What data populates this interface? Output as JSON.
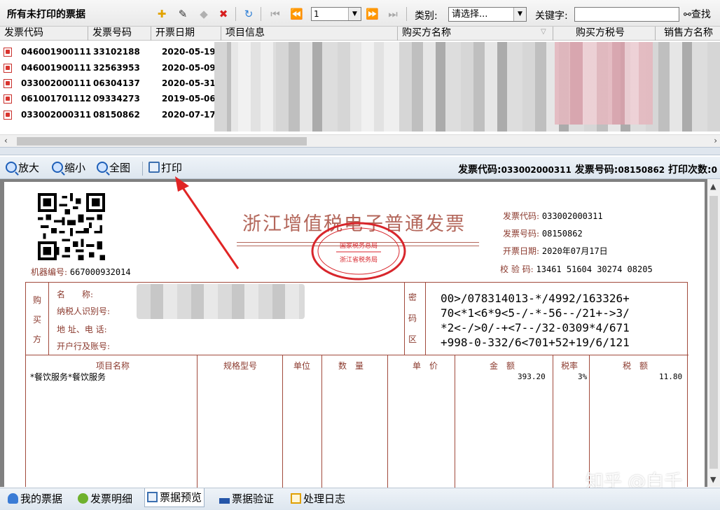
{
  "toolbar": {
    "title": "所有未打印的票据",
    "page_value": "1",
    "category_label": "类别:",
    "category_value": "请选择...",
    "keyword_label": "关键字:",
    "keyword_value": "",
    "find_label": "查找"
  },
  "grid": {
    "columns": [
      "发票代码",
      "发票号码",
      "开票日期",
      "项目信息",
      "购买方名称",
      "购买方税号",
      "销售方名称"
    ],
    "rows": [
      {
        "code": "046001900111",
        "number": "33102188",
        "date": "2020-05-19"
      },
      {
        "code": "046001900111",
        "number": "32563953",
        "date": "2020-05-09"
      },
      {
        "code": "033002000111",
        "number": "06304137",
        "date": "2020-05-31"
      },
      {
        "code": "061001701112",
        "number": "09334273",
        "date": "2019-05-06"
      },
      {
        "code": "033002000311",
        "number": "08150862",
        "date": "2020-07-17"
      }
    ]
  },
  "preview_toolbar": {
    "zoom_in": "放大",
    "zoom_out": "缩小",
    "fit": "全图",
    "print": "打印",
    "info_code_label": "发票代码:",
    "info_code": "033002000311",
    "info_number_label": "发票号码:",
    "info_number": "08150862",
    "info_print_label": "打印次数:",
    "info_print_count": "0"
  },
  "invoice": {
    "title": "浙江增值税电子普通发票",
    "seal_line1": "国家税务总局",
    "seal_line2": "浙江省税务局",
    "machine_label": "机器编号:",
    "machine_no": "667000932014",
    "code_label": "发票代码:",
    "code": "033002000311",
    "number_label": "发票号码:",
    "number": "08150862",
    "date_label": "开票日期:",
    "date": "2020年07月17日",
    "check_label": "校 验 码:",
    "check": "13461 51604 30274 08205",
    "buyer_side": [
      "购",
      "买",
      "方"
    ],
    "buyer_fields": [
      "名　　称:",
      "纳税人识别号:",
      "地 址、电 话:",
      "开户行及账号:"
    ],
    "pw_side": [
      "密",
      "码",
      "区"
    ],
    "cipher": [
      "00>/078314013-*/4992/163326+",
      "70<*1<6*9<5-/-*-56--/21+->3/",
      "*2<-/>0/-+<7--/32-0309*4/671",
      "+998-0-332/6<701+52+19/6/121"
    ],
    "col_item": "项目名称",
    "col_spec": "规格型号",
    "col_unit": "单位",
    "col_qty": "数　量",
    "col_price": "单　价",
    "col_amount": "金　额",
    "col_rate": "税率",
    "col_tax": "税　额",
    "item_name": "*餐饮服务*餐饮服务",
    "item_amount": "393.20",
    "item_rate": "3%",
    "item_tax": "11.80"
  },
  "watermark": "知乎 @白千",
  "bottom_tabs": [
    "我的票据",
    "发票明细",
    "票据预览",
    "票据验证",
    "处理日志"
  ],
  "active_tab": "票据预览"
}
